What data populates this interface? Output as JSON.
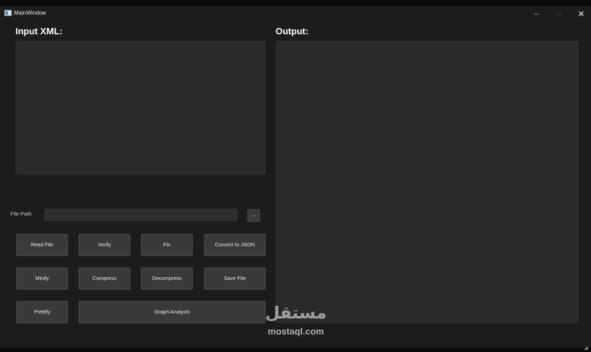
{
  "window": {
    "title": "MainWindow",
    "controls": {
      "minimize": "–",
      "maximize": "□",
      "close": "✕"
    }
  },
  "input": {
    "heading": "Input XML:"
  },
  "output": {
    "heading": "Output:"
  },
  "file_path": {
    "label": "File Path:",
    "value": "",
    "browse_label": "..."
  },
  "buttons": {
    "read_file": "Read File",
    "verify": "Verify",
    "fix": "Fix",
    "convert_json": "Convert to JSON",
    "minify": "Minify",
    "compress": "Compress",
    "decompress": "Decompress",
    "save_file": "Save File",
    "prettify": "Prettify",
    "graph_analysis": "Graph Analysis"
  },
  "watermark": {
    "arabic": "مستقل",
    "latin": "mostaql.com"
  },
  "colors": {
    "window_bg": "#1c1c1c",
    "panel_bg": "#2b2b2b",
    "button_bg": "#3a3a3a",
    "text": "#e8e8e8"
  }
}
